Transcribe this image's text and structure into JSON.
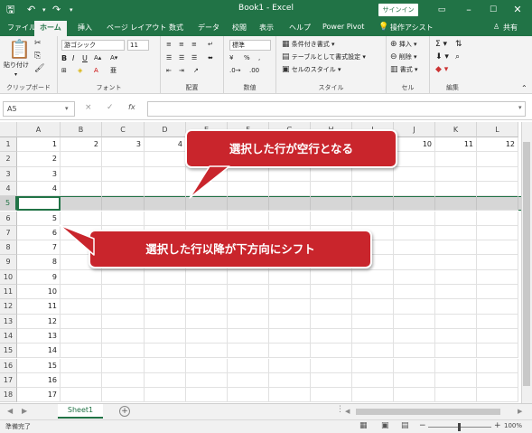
{
  "titlebar": {
    "title": "Book1 - Excel",
    "signin": "サインイン",
    "save_icon": "save-icon",
    "undo_icon": "undo-icon",
    "redo_icon": "redo-icon"
  },
  "tabs": [
    "ファイル",
    "ホーム",
    "挿入",
    "ページ レイアウト",
    "数式",
    "データ",
    "校閲",
    "表示",
    "ヘルプ",
    "Power Pivot",
    "操作アシスト",
    "共有"
  ],
  "ribbon": {
    "clipboard": {
      "paste": "貼り付け",
      "label": "クリップボード"
    },
    "font": {
      "name": "游ゴシック",
      "size": "11",
      "label": "フォント"
    },
    "alignment": {
      "label": "配置"
    },
    "number": {
      "format": "標準",
      "label": "数値"
    },
    "styles": {
      "cond": "条件付き書式",
      "table": "テーブルとして書式設定",
      "cell": "セルのスタイル",
      "label": "スタイル"
    },
    "cells": {
      "insert": "挿入",
      "delete": "削除",
      "format": "書式",
      "label": "セル"
    },
    "editing": {
      "label": "編集"
    }
  },
  "formula": {
    "namebox": "A5",
    "fx": "fx",
    "cancel": "×",
    "enter": "✓"
  },
  "columns": [
    "A",
    "B",
    "C",
    "D",
    "E",
    "F",
    "G",
    "H",
    "I",
    "J",
    "K",
    "L"
  ],
  "rows": [
    "1",
    "2",
    "3",
    "4",
    "5",
    "6",
    "7",
    "8",
    "9",
    "10",
    "11",
    "12",
    "13",
    "14",
    "15",
    "16",
    "17",
    "18"
  ],
  "row1_values": [
    "1",
    "2",
    "3",
    "4",
    "",
    "",
    "",
    "",
    "",
    "10",
    "11",
    "12"
  ],
  "colA_values": [
    "1",
    "2",
    "3",
    "4",
    "",
    "5",
    "6",
    "7",
    "8",
    "9",
    "10",
    "11",
    "12",
    "13",
    "14",
    "15",
    "16",
    "17"
  ],
  "sheet": {
    "name": "Sheet1",
    "add": "+"
  },
  "status": {
    "ready": "準備完了",
    "zoom": "100%",
    "minus": "−",
    "plus": "+"
  },
  "callouts": {
    "top": "選択した行が空行となる",
    "bottom": "選択した行以降が下方向にシフト"
  }
}
